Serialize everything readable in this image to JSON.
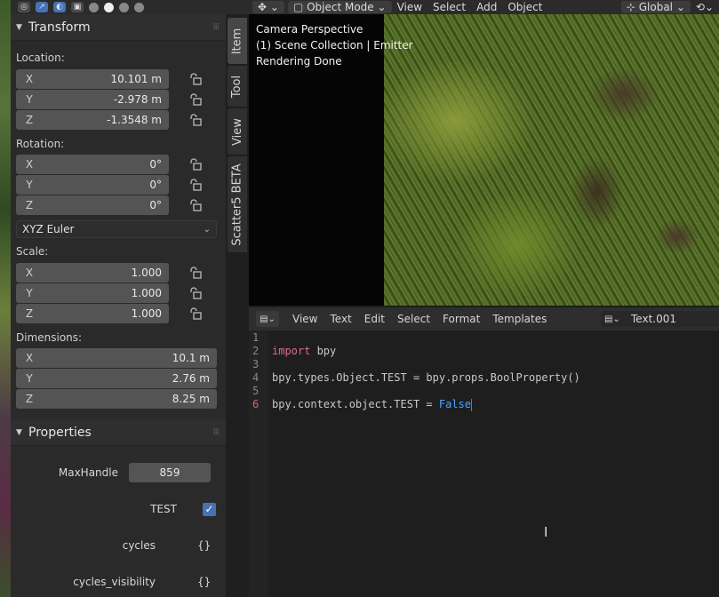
{
  "viewport_header": {
    "mode": "Object Mode",
    "menus": [
      "View",
      "Select",
      "Add",
      "Object"
    ],
    "transform_orientation": "Global"
  },
  "viewport": {
    "overlay_lines": [
      "Camera Perspective",
      "(1) Scene Collection | Emitter",
      "Rendering Done"
    ]
  },
  "tabs": [
    "Item",
    "Tool",
    "View",
    "Scatter5 BETA"
  ],
  "transform": {
    "title": "Transform",
    "location_label": "Location:",
    "location": [
      {
        "axis": "X",
        "value": "10.101 m"
      },
      {
        "axis": "Y",
        "value": "-2.978 m"
      },
      {
        "axis": "Z",
        "value": "-1.3548 m"
      }
    ],
    "rotation_label": "Rotation:",
    "rotation": [
      {
        "axis": "X",
        "value": "0°"
      },
      {
        "axis": "Y",
        "value": "0°"
      },
      {
        "axis": "Z",
        "value": "0°"
      }
    ],
    "rotation_mode": "XYZ Euler",
    "scale_label": "Scale:",
    "scale": [
      {
        "axis": "X",
        "value": "1.000"
      },
      {
        "axis": "Y",
        "value": "1.000"
      },
      {
        "axis": "Z",
        "value": "1.000"
      }
    ],
    "dimensions_label": "Dimensions:",
    "dimensions": [
      {
        "axis": "X",
        "value": "10.1 m"
      },
      {
        "axis": "Y",
        "value": "2.76 m"
      },
      {
        "axis": "Z",
        "value": "8.25 m"
      }
    ]
  },
  "properties": {
    "title": "Properties",
    "maxhandle_label": "MaxHandle",
    "maxhandle_value": "859",
    "test_label": "TEST",
    "test_checked": true,
    "cycles_label": "cycles",
    "cycles_value": "{}",
    "cycles_visibility_label": "cycles_visibility",
    "cycles_visibility_value": "{}"
  },
  "text_editor": {
    "menus": [
      "View",
      "Text",
      "Edit",
      "Select",
      "Format",
      "Templates"
    ],
    "text_name": "Text.001",
    "line_numbers": [
      "1",
      "2",
      "3",
      "4",
      "5",
      "6"
    ],
    "line2_kw": "import",
    "line2_rest": " bpy",
    "line4": "bpy.types.Object.TEST = bpy.props.BoolProperty()",
    "line6_prefix": "bpy.context.object.TEST = ",
    "line6_bool": "False"
  }
}
